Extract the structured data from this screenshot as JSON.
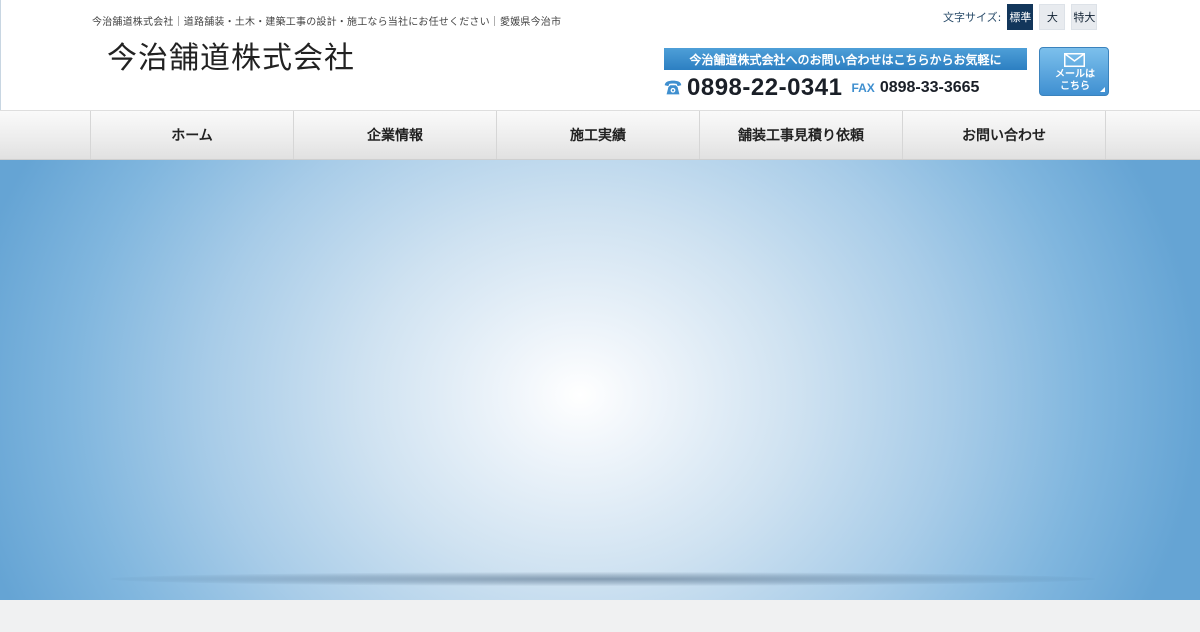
{
  "header": {
    "tagline": "今治舗道株式会社｜道路舗装・土木・建築工事の設計・施工なら当社にお任せください｜愛媛県今治市",
    "site_title": "今治舗道株式会社",
    "font_size": {
      "label": "文字サイズ:",
      "options": [
        {
          "label": "標準",
          "active": true
        },
        {
          "label": "大",
          "active": false
        },
        {
          "label": "特大",
          "active": false
        }
      ]
    },
    "contact": {
      "banner": "今治舗道株式会社へのお問い合わせはこちらからお気軽に",
      "tel_icon": "telephone-icon",
      "tel": "0898-22-0341",
      "fax_label": "FAX",
      "fax": "0898-33-3665"
    },
    "mail_button": {
      "icon": "envelope-icon",
      "label": "メールは\nこちら"
    }
  },
  "nav": {
    "items": [
      {
        "label": "ホーム"
      },
      {
        "label": "企業情報"
      },
      {
        "label": "施工実績"
      },
      {
        "label": "舗装工事見積り依頼"
      },
      {
        "label": "お問い合わせ"
      }
    ]
  },
  "colors": {
    "accent": "#2c7fc2",
    "nav_active": "#12365b",
    "hero_edge": "#65a4d4"
  }
}
